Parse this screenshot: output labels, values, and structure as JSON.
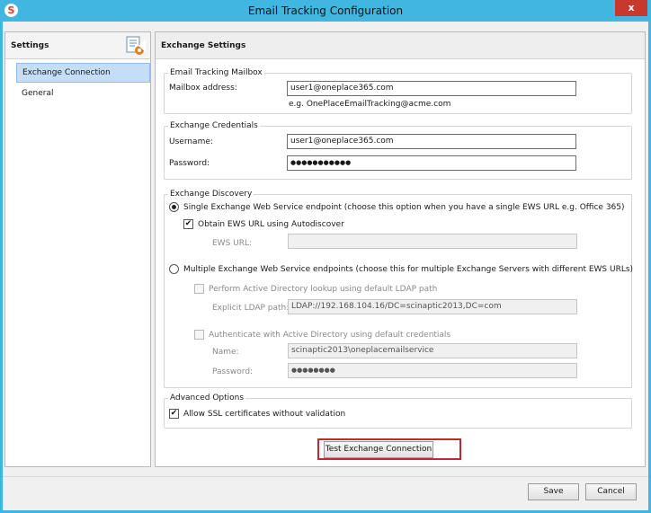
{
  "window": {
    "title": "Email Tracking Configuration",
    "app_icon": "S",
    "close_glyph": "x"
  },
  "nav": {
    "header": "Settings",
    "items": [
      {
        "label": "Exchange Connection",
        "selected": true
      },
      {
        "label": "General",
        "selected": false
      }
    ]
  },
  "main": {
    "header": "Exchange Settings",
    "mailbox": {
      "title": "Email Tracking Mailbox",
      "address_label": "Mailbox address:",
      "address_value": "user1@oneplace365.com",
      "example": "e.g. OnePlaceEmailTracking@acme.com"
    },
    "credentials": {
      "title": "Exchange Credentials",
      "username_label": "Username:",
      "username_value": "user1@oneplace365.com",
      "password_label": "Password:",
      "password_value": "●●●●●●●●●●●"
    },
    "discovery": {
      "title": "Exchange Discovery",
      "single_label": "Single Exchange Web Service endpoint (choose this option when you have a single EWS URL e.g. Office 365)",
      "single_selected": true,
      "autodiscover_label": "Obtain EWS URL using Autodiscover",
      "autodiscover_checked": true,
      "ews_url_label": "EWS URL:",
      "ews_url_value": "",
      "multiple_label": "Multiple Exchange Web Service endpoints (choose this for multiple Exchange Servers with different EWS URLs)",
      "multiple_selected": false,
      "ad_lookup_label": "Perform Active Directory lookup using default LDAP path",
      "ldap_label": "Explicit LDAP path:",
      "ldap_value": "LDAP://192.168.104.16/DC=scinaptic2013,DC=com",
      "ad_auth_label": "Authenticate with Active Directory using default credentials",
      "name_label": "Name:",
      "name_value": "scinaptic2013\\oneplacemailservice",
      "password_label": "Password:",
      "password_value": "●●●●●●●●"
    },
    "advanced": {
      "title": "Advanced Options",
      "ssl_label": "Allow SSL certificates without validation",
      "ssl_checked": true
    },
    "test_button": "Test Exchange Connection"
  },
  "footer": {
    "save": "Save",
    "cancel": "Cancel"
  },
  "colors": {
    "titlebar": "#40b6e0",
    "close": "#c8382c",
    "selection": "#c3def6",
    "highlight": "#c2282d"
  },
  "checkmark": "✔"
}
